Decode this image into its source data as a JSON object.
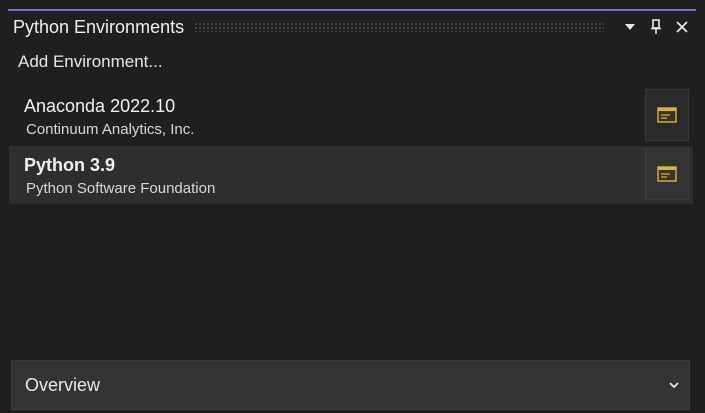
{
  "window": {
    "title": "Python Environments",
    "buttons": [
      "dropdown-icon",
      "pin-icon",
      "close-icon"
    ]
  },
  "add_environment": {
    "label": "Add Environment..."
  },
  "environments": [
    {
      "name": "Anaconda 2022.10",
      "vendor": "Continuum Analytics, Inc.",
      "selected": false,
      "icon": "console-icon"
    },
    {
      "name": "Python 3.9",
      "vendor": "Python Software Foundation",
      "selected": true,
      "icon": "console-icon"
    }
  ],
  "overview": {
    "label": "Overview",
    "icon": "chevron-down-icon"
  },
  "colors": {
    "accent": "#7b68c9",
    "background": "#1f1f1f",
    "selected_row": "#2e2e2e",
    "console_icon": "#d8b53a"
  }
}
